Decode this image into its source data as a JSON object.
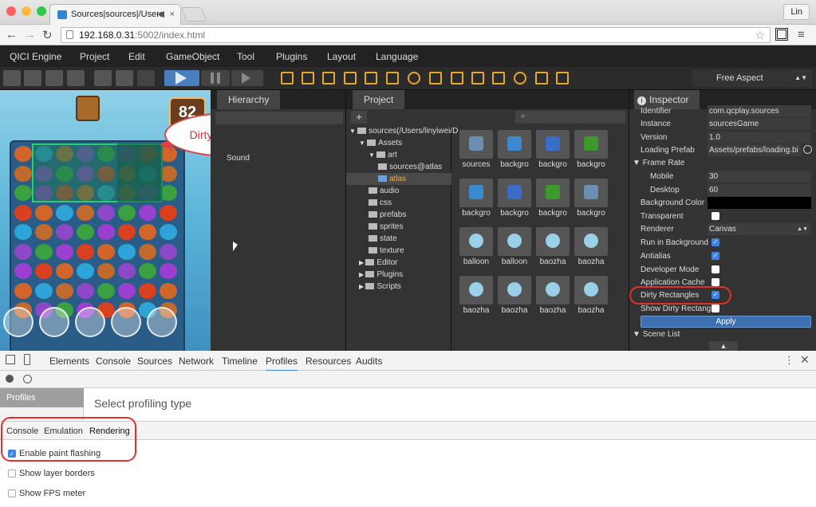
{
  "browser": {
    "tab_title": "Sources|sources|/Users",
    "user": "Lin",
    "url_host": "192.168.0.31",
    "url_rest": ":5002/index.html"
  },
  "menu": [
    "QICI Engine",
    "Project",
    "Edit",
    "GameObject",
    "Tool",
    "Plugins",
    "Layout",
    "Language"
  ],
  "toolbar": {
    "aspect": "Free Aspect"
  },
  "game": {
    "score": "82",
    "callout": "Dirty Rectangles"
  },
  "hierarchy": {
    "title": "Hierarchy",
    "items": [
      "Sound"
    ]
  },
  "project": {
    "title": "Project",
    "add": "+",
    "tree": [
      {
        "label": "sources(/Users/linyiwei/D",
        "indent": 0,
        "arrow": "▼"
      },
      {
        "label": "Assets",
        "indent": 1,
        "arrow": "▼"
      },
      {
        "label": "art",
        "indent": 2,
        "arrow": "▼"
      },
      {
        "label": "sources@atlas",
        "indent": 3,
        "arrow": ""
      },
      {
        "label": "atlas",
        "indent": 2,
        "arrow": "",
        "selected": true
      },
      {
        "label": "audio",
        "indent": 2,
        "arrow": ""
      },
      {
        "label": "css",
        "indent": 2,
        "arrow": ""
      },
      {
        "label": "prefabs",
        "indent": 2,
        "arrow": ""
      },
      {
        "label": "sprites",
        "indent": 2,
        "arrow": ""
      },
      {
        "label": "state",
        "indent": 2,
        "arrow": ""
      },
      {
        "label": "texture",
        "indent": 2,
        "arrow": ""
      },
      {
        "label": "Editor",
        "indent": 1,
        "arrow": "▶"
      },
      {
        "label": "Plugins",
        "indent": 1,
        "arrow": "▶"
      },
      {
        "label": "Scripts",
        "indent": 1,
        "arrow": "▶"
      }
    ],
    "assets": [
      [
        "sources",
        "backgro",
        "backgro",
        "backgro"
      ],
      [
        "backgro",
        "backgro",
        "backgro",
        "backgro"
      ],
      [
        "balloon",
        "balloon",
        "baozha",
        "baozha"
      ],
      [
        "baozha",
        "baozha",
        "baozha",
        "baozha"
      ]
    ]
  },
  "inspector": {
    "title": "Inspector",
    "identifier_label": "Identifier",
    "identifier": "com.qcplay.sources",
    "instance_label": "Instance",
    "instance": "sourcesGame",
    "version_label": "Version",
    "version": "1.0",
    "loading_label": "Loading Prefab",
    "loading": "Assets/prefabs/loading.bi",
    "frame_rate_label": "Frame Rate",
    "mobile_label": "Mobile",
    "mobile": "30",
    "desktop_label": "Desktop",
    "desktop": "60",
    "bg_label": "Background Color",
    "transparent_label": "Transparent",
    "renderer_label": "Renderer",
    "renderer": "Canvas",
    "run_bg_label": "Run in Background",
    "antialias_label": "Antialias",
    "dev_mode_label": "Developer Mode",
    "app_cache_label": "Application Cache",
    "dirty_label": "Dirty Rectangles",
    "show_dirty_label": "Show Dirty Rectangl",
    "apply": "Apply",
    "scene_list": "Scene List"
  },
  "devtools": {
    "tabs": [
      "Elements",
      "Console",
      "Sources",
      "Network",
      "Timeline",
      "Profiles",
      "Resources",
      "Audits"
    ],
    "active_tab": "Profiles",
    "side": "Profiles",
    "select_type": "Select profiling type",
    "drawer_tabs": [
      "Console",
      "Emulation",
      "Rendering"
    ],
    "options": [
      {
        "label": "Enable paint flashing",
        "checked": true
      },
      {
        "label": "Show layer borders",
        "checked": false
      },
      {
        "label": "Show FPS meter",
        "checked": false
      }
    ]
  },
  "colors": {
    "accent": "#3b84e8",
    "highlight": "#e03030",
    "toolbar_icon": "#e8a92b"
  }
}
